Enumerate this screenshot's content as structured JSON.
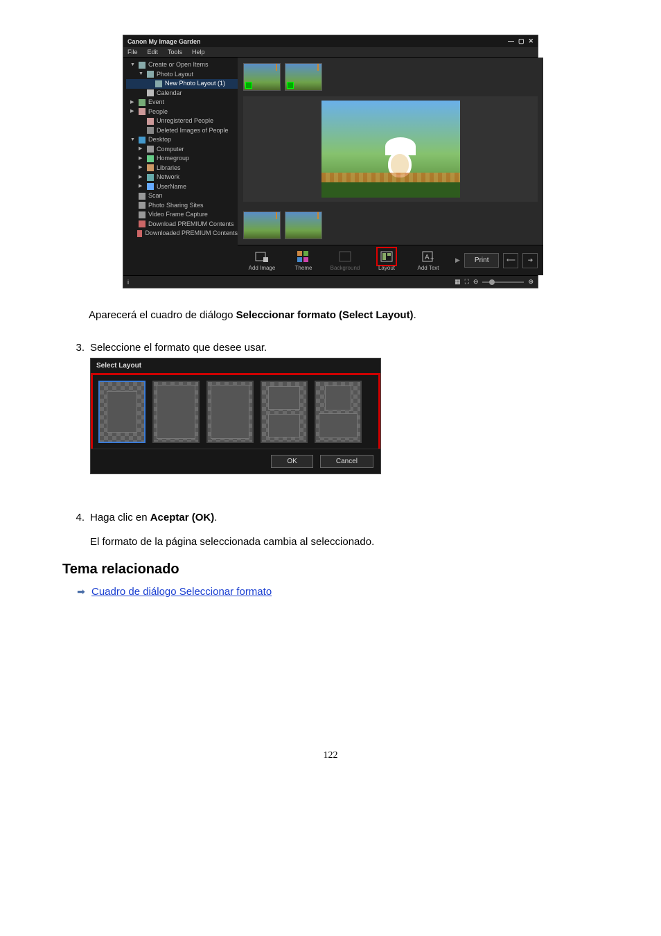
{
  "app": {
    "title": "Canon My Image Garden",
    "menus": [
      "File",
      "Edit",
      "Tools",
      "Help"
    ],
    "tree": [
      {
        "label": "Create or Open Items",
        "depth": 0,
        "arrow": "▼",
        "icon": "#8aa"
      },
      {
        "label": "Photo Layout",
        "depth": 1,
        "arrow": "▼",
        "icon": "#8aa"
      },
      {
        "label": "New Photo Layout (1)",
        "depth": 2,
        "arrow": "",
        "icon": "#8aa",
        "selected": true
      },
      {
        "label": "Calendar",
        "depth": 1,
        "arrow": "",
        "icon": "#bbb"
      },
      {
        "label": "Event",
        "depth": 0,
        "arrow": "▶",
        "icon": "#7a7"
      },
      {
        "label": "People",
        "depth": 0,
        "arrow": "▶",
        "icon": "#c99"
      },
      {
        "label": "Unregistered People",
        "depth": 1,
        "arrow": "",
        "icon": "#c99"
      },
      {
        "label": "Deleted Images of People",
        "depth": 1,
        "arrow": "",
        "icon": "#888"
      },
      {
        "label": "Desktop",
        "depth": 0,
        "arrow": "▼",
        "icon": "#49c"
      },
      {
        "label": "Computer",
        "depth": 1,
        "arrow": "▶",
        "icon": "#999"
      },
      {
        "label": "Homegroup",
        "depth": 1,
        "arrow": "▶",
        "icon": "#6c8"
      },
      {
        "label": "Libraries",
        "depth": 1,
        "arrow": "▶",
        "icon": "#c96"
      },
      {
        "label": "Network",
        "depth": 1,
        "arrow": "▶",
        "icon": "#6aa"
      },
      {
        "label": "UserName",
        "depth": 1,
        "arrow": "▶",
        "icon": "#6af"
      },
      {
        "label": "Scan",
        "depth": 0,
        "arrow": "",
        "icon": "#999"
      },
      {
        "label": "Photo Sharing Sites",
        "depth": 0,
        "arrow": "",
        "icon": "#999"
      },
      {
        "label": "Video Frame Capture",
        "depth": 0,
        "arrow": "",
        "icon": "#999"
      },
      {
        "label": "Download PREMIUM Contents",
        "depth": 0,
        "arrow": "",
        "icon": "#c66"
      },
      {
        "label": "Downloaded PREMIUM Contents",
        "depth": 0,
        "arrow": "",
        "icon": "#c66"
      }
    ],
    "tools": {
      "add_image": "Add Image",
      "theme": "Theme",
      "background": "Background",
      "layout": "Layout",
      "add_text": "Add Text",
      "print": "Print"
    },
    "status_info": "i"
  },
  "text": {
    "caption1_pre": "Aparecerá el cuadro de diálogo ",
    "caption1_bold": "Seleccionar formato (Select Layout)",
    "caption1_post": ".",
    "step3_num": "3.",
    "step3": "Seleccione el formato que desee usar.",
    "step4_num": "4.",
    "step4_pre": "Haga clic en ",
    "step4_bold": "Aceptar (OK)",
    "step4_post": ".",
    "step4_sub": "El formato de la página seleccionada cambia al seleccionado."
  },
  "dialog": {
    "title": "Select Layout",
    "ok": "OK",
    "cancel": "Cancel"
  },
  "related": {
    "heading": "Tema relacionado",
    "link": "Cuadro de diálogo Seleccionar formato"
  },
  "page_number": "122"
}
